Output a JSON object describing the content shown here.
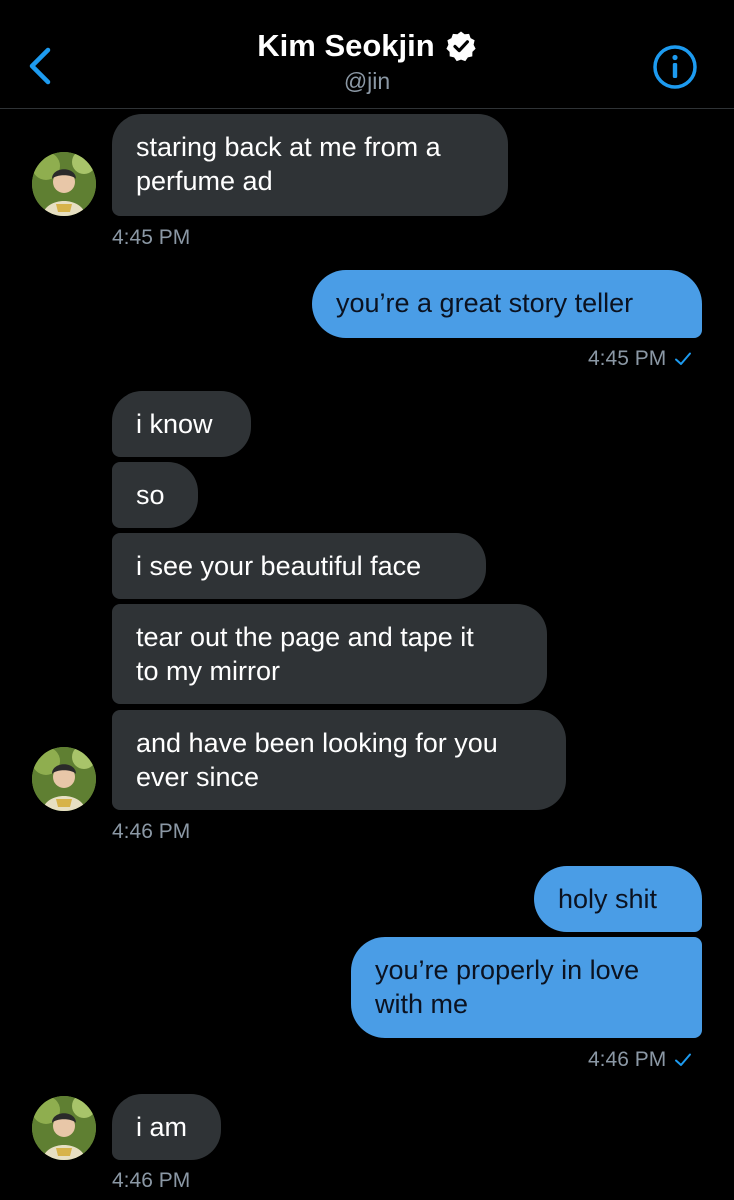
{
  "header": {
    "name": "Kim Seokjin",
    "handle": "@jin",
    "back_icon": "chevron-left-icon",
    "verified_icon": "verified-badge-icon",
    "info_icon": "info-icon"
  },
  "colors": {
    "accent": "#1d9bf0",
    "incoming_bubble": "#2f3336",
    "outgoing_bubble": "#4a9de6",
    "timestamp": "#8b98a5",
    "background": "#000000"
  },
  "messages": {
    "m1": "staring back at me from a",
    "m1b": "perfume ad",
    "t1": "4:45 PM",
    "m2": "you’re a great story teller",
    "t2": "4:45 PM",
    "m3": "i know",
    "m4": "so",
    "m5": "i see your beautiful face",
    "m6": "tear out the page and tape it",
    "m6b": "to my mirror",
    "m7": "and have been looking for you",
    "m7b": "ever since",
    "t3": "4:46 PM",
    "m8": "holy shit",
    "m9": "you’re properly in love",
    "m9b": "with me",
    "t4": "4:46 PM",
    "m10": "i am",
    "t5": "4:46 PM"
  }
}
